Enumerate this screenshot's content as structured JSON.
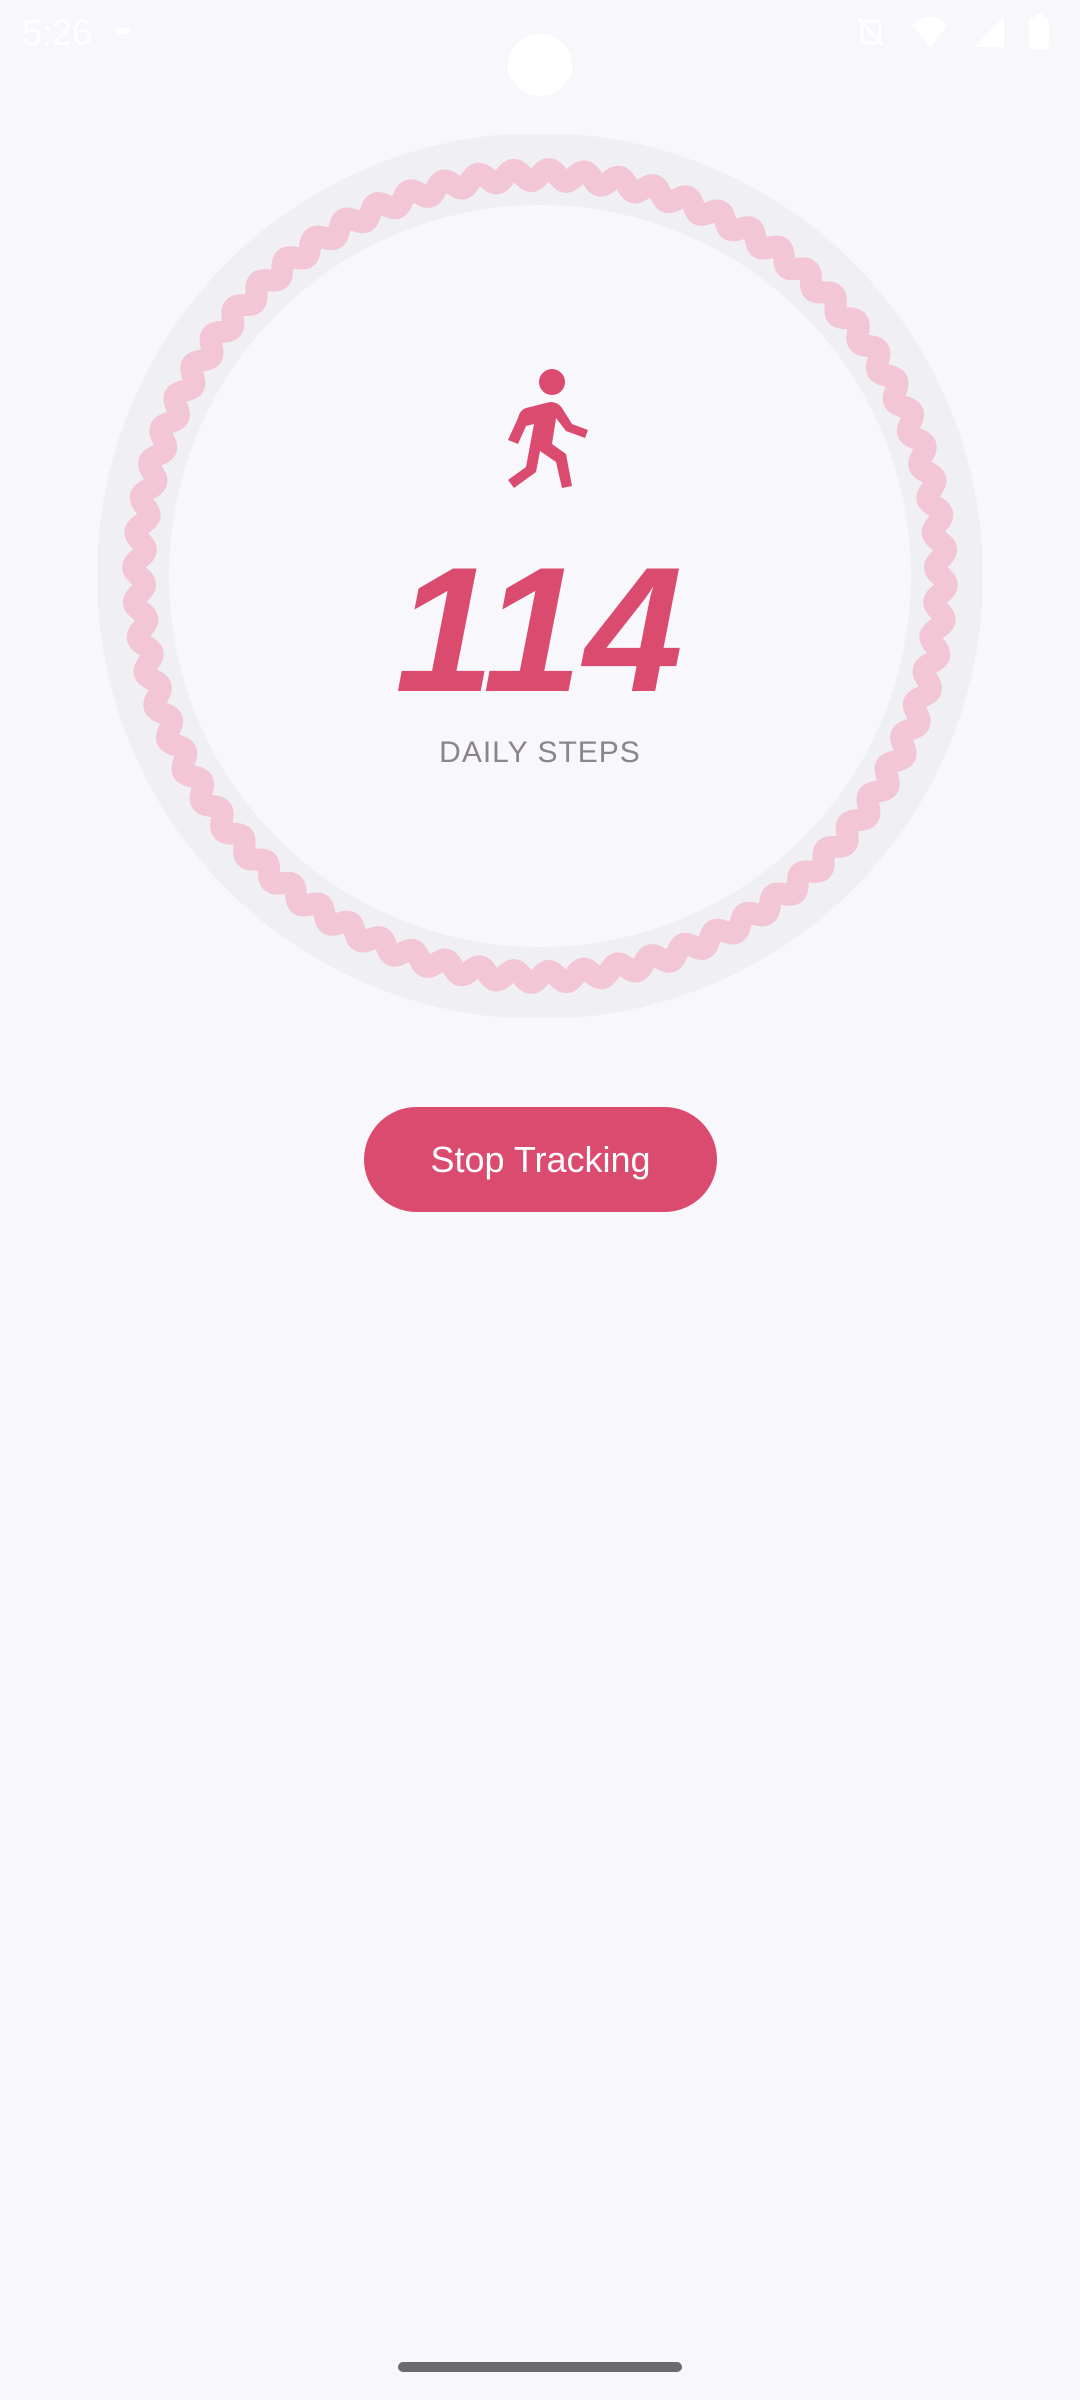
{
  "status_bar": {
    "time": "5:26",
    "icons": [
      "notification-dot-icon",
      "nfc-off-icon",
      "wifi-icon",
      "signal-icon",
      "battery-icon"
    ]
  },
  "tracker": {
    "icon": "walking-person-icon",
    "step_count": "114",
    "label": "DAILY STEPS",
    "progress_ring": "step-goal-progress"
  },
  "actions": {
    "stop_label": "Stop Tracking"
  },
  "colors": {
    "accent": "#db4b6f",
    "ring_track": "#f0f0f4",
    "ring_wave": "#f2c6d4",
    "background": "#f7f7fc",
    "label": "#8b8589"
  }
}
